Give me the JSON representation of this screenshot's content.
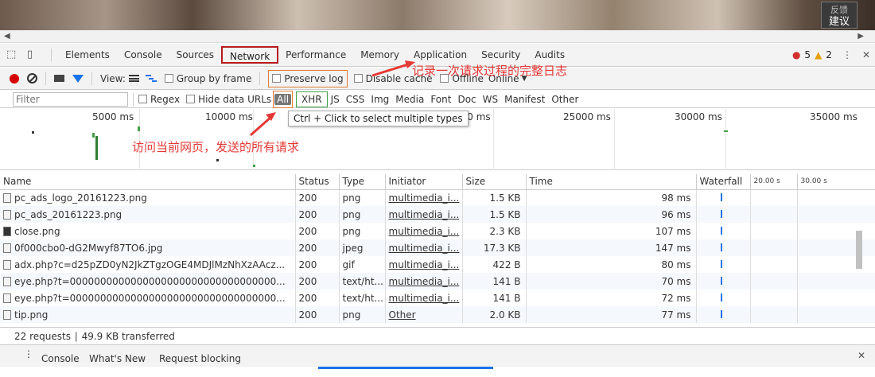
{
  "feedback": {
    "line1": "反馈",
    "line2": "建议"
  },
  "tabs": [
    "Elements",
    "Console",
    "Sources",
    "Network",
    "Performance",
    "Memory",
    "Application",
    "Security",
    "Audits"
  ],
  "active_tab": "Network",
  "status_counts": {
    "errors": "5",
    "warnings": "2"
  },
  "toolbar": {
    "view_label": "View:",
    "group_by_frame": "Group by frame",
    "preserve_log": "Preserve log",
    "disable_cache": "Disable cache",
    "offline": "Offline",
    "online": "Online"
  },
  "filter": {
    "placeholder": "Filter",
    "regex": "Regex",
    "hide_data_urls": "Hide data URLs",
    "types": [
      "All",
      "XHR",
      "JS",
      "CSS",
      "Img",
      "Media",
      "Font",
      "Doc",
      "WS",
      "Manifest",
      "Other"
    ]
  },
  "tooltip": "Ctrl + Click to select multiple types",
  "overview_ticks": [
    "5000 ms",
    "10000 ms",
    "000 ms",
    "25000 ms",
    "30000 ms",
    "35000 ms"
  ],
  "annotations": {
    "preserve_note": "记录一次请求过程的完整日志",
    "requests_note": "访问当前网页，发送的所有请求"
  },
  "columns": {
    "name": "Name",
    "status": "Status",
    "type": "Type",
    "initiator": "Initiator",
    "size": "Size",
    "time": "Time",
    "waterfall": "Waterfall",
    "t20": "20.00 s",
    "t30": "30.00 s"
  },
  "rows": [
    {
      "name": "pc_ads_logo_20161223.png",
      "status": "200",
      "type": "png",
      "initiator": "multimedia_i...",
      "size": "1.5 KB",
      "time": "98 ms",
      "icon": "light"
    },
    {
      "name": "pc_ads_20161223.png",
      "status": "200",
      "type": "png",
      "initiator": "multimedia_i...",
      "size": "1.5 KB",
      "time": "96 ms",
      "icon": "light"
    },
    {
      "name": "close.png",
      "status": "200",
      "type": "png",
      "initiator": "multimedia_i...",
      "size": "2.3 KB",
      "time": "107 ms",
      "icon": "dark"
    },
    {
      "name": "0f000cbo0-dG2Mwyf87TO6.jpg",
      "status": "200",
      "type": "jpeg",
      "initiator": "multimedia_i...",
      "size": "17.3 KB",
      "time": "147 ms",
      "icon": "light"
    },
    {
      "name": "adx.php?c=d25pZD0yN2JkZTgzOGE4MDJlMzNhXzAAcz...",
      "status": "200",
      "type": "gif",
      "initiator": "multimedia_i...",
      "size": "422 B",
      "time": "80 ms",
      "icon": "light"
    },
    {
      "name": "eye.php?t=0000000000000000000000000000000000...",
      "status": "200",
      "type": "text/ht...",
      "initiator": "multimedia_i...",
      "size": "141 B",
      "time": "70 ms",
      "icon": "light"
    },
    {
      "name": "eye.php?t=0000000000000000000000000000000000...",
      "status": "200",
      "type": "text/ht...",
      "initiator": "multimedia_i...",
      "size": "141 B",
      "time": "72 ms",
      "icon": "light"
    },
    {
      "name": "tip.png",
      "status": "200",
      "type": "png",
      "initiator": "Other",
      "size": "2.0 KB",
      "time": "77 ms",
      "icon": "light"
    }
  ],
  "statusbar": "22 requests ∣ 49.9 KB transferred",
  "drawer_tabs": [
    "Console",
    "What's New",
    "Request blocking"
  ]
}
